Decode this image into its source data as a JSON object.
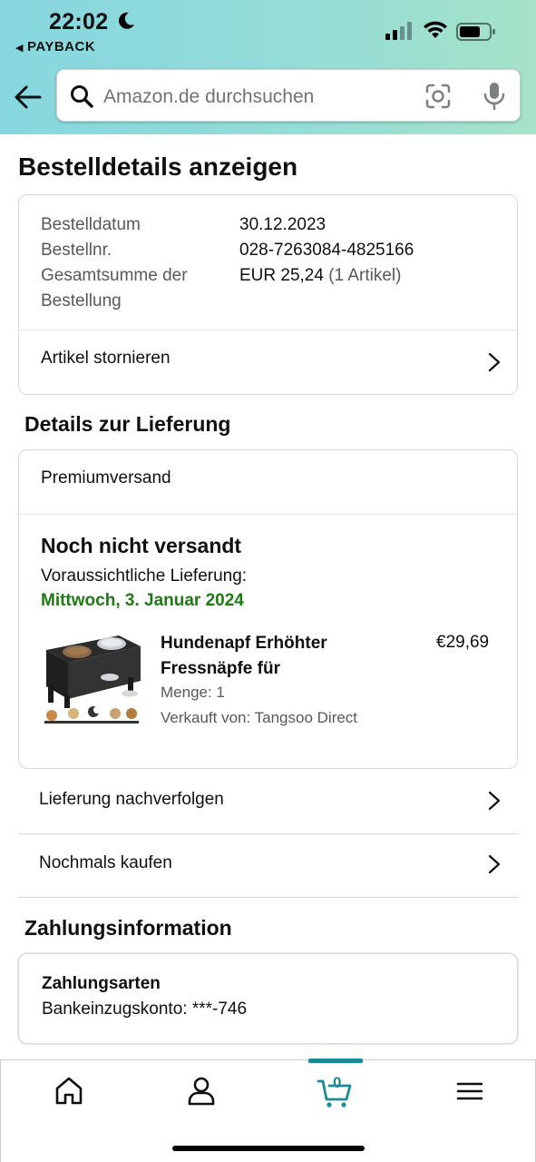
{
  "status_bar": {
    "time": "22:02",
    "back_app": "PAYBACK"
  },
  "search": {
    "placeholder": "Amazon.de durchsuchen"
  },
  "page": {
    "title": "Bestelldetails anzeigen"
  },
  "order_summary": {
    "date_label": "Bestelldatum",
    "date_value": "30.12.2023",
    "number_label": "Bestellnr.",
    "number_value": "028-7263084-4825166",
    "total_label_line1": "Gesamtsumme der",
    "total_label_line2": "Bestellung",
    "total_value": "EUR 25,24",
    "total_items": "(1 Artikel)",
    "cancel_label": "Artikel stornieren"
  },
  "delivery": {
    "section_title": "Details zur Lieferung",
    "shipping_method": "Premiumversand",
    "status": "Noch nicht versandt",
    "expected_label": "Voraussichtliche Lieferung:",
    "expected_date": "Mittwoch, 3. Januar 2024",
    "product": {
      "name_line1": "Hundenapf Erhöhter",
      "name_line2": "Fressnäpfe für",
      "price": "€29,69",
      "quantity": "Menge: 1",
      "seller": "Verkauft von: Tangsoo Direct"
    },
    "track_label": "Lieferung nachverfolgen",
    "buy_again_label": "Nochmals kaufen"
  },
  "payment": {
    "section_title": "Zahlungsinformation",
    "method_title": "Zahlungsarten",
    "method_value": "Bankeinzugskonto: ***-746"
  },
  "bottom_nav": {
    "cart_count": "0",
    "items": [
      "home-icon",
      "account-icon",
      "cart-icon",
      "menu-icon"
    ],
    "active_color": "#1b8a96"
  },
  "colors": {
    "delivery_date_green": "#1e7a13",
    "header_gradient_start": "#86d7df",
    "header_gradient_end": "#a6e3c8"
  }
}
